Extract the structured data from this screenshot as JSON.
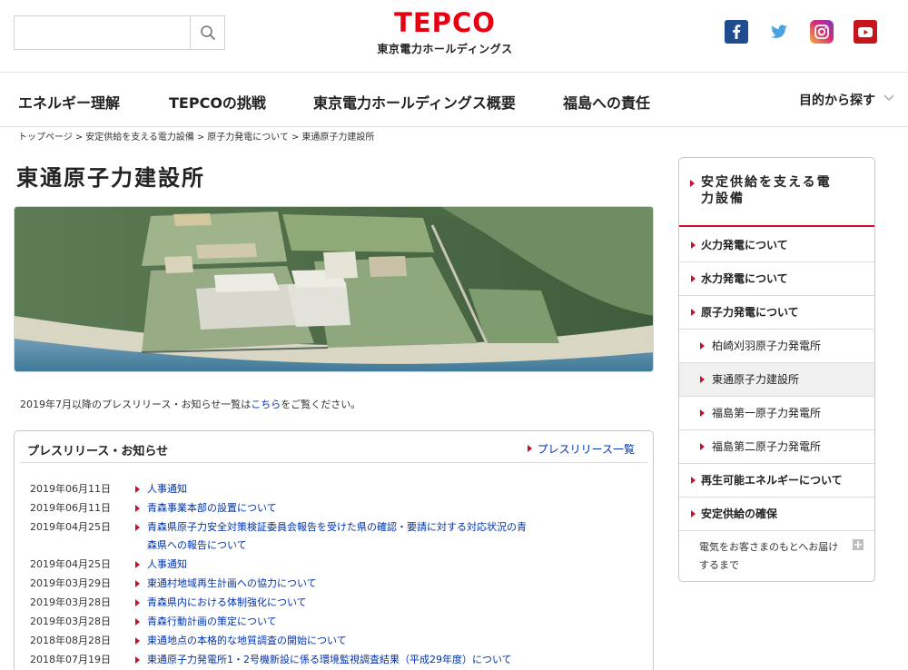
{
  "header": {
    "search_placeholder": "",
    "logo_text": "TEPCO",
    "logo_subtext": "東京電力ホールディングス"
  },
  "social": {
    "facebook": "f",
    "icons": [
      "facebook-icon",
      "twitter-icon",
      "instagram-icon",
      "youtube-icon"
    ]
  },
  "nav": {
    "items": [
      "エネルギー理解",
      "TEPCOの挑戦",
      "東京電力ホールディングス概要",
      "福島への責任"
    ],
    "right_label": "目的から探す"
  },
  "breadcrumb": [
    "トップページ",
    "安定供給を支える電力設備",
    "原子力発電について",
    "東通原子力建設所"
  ],
  "page": {
    "title": "東通原子力建設所"
  },
  "notice": {
    "before": "2019年7月以降のプレスリリース・お知らせ一覧は",
    "link": "こちら",
    "after": "をご覧ください。"
  },
  "press": {
    "heading": "プレスリリース・お知らせ",
    "all_link": "プレスリリース一覧",
    "items": [
      {
        "date": "2019年06月11日",
        "title": "人事通知"
      },
      {
        "date": "2019年06月11日",
        "title": "青森事業本部の設置について"
      },
      {
        "date": "2019年04月25日",
        "title": "青森県原子力安全対策検証委員会報告を受けた県の確認・要請に対する対応状況の青森県への報告について"
      },
      {
        "date": "2019年04月25日",
        "title": "人事通知"
      },
      {
        "date": "2019年03月29日",
        "title": "東通村地域再生計画への協力について"
      },
      {
        "date": "2019年03月28日",
        "title": "青森県内における体制強化について"
      },
      {
        "date": "2019年03月28日",
        "title": "青森行動計画の策定について"
      },
      {
        "date": "2018年08月28日",
        "title": "東通地点の本格的な地質調査の開始について"
      },
      {
        "date": "2018年07月19日",
        "title": "東通原子力発電所1・2号機新設に係る環境監視調査結果（平成29年度）について"
      }
    ]
  },
  "sidebar": {
    "heading": "安定供給を支える電力設備",
    "items": [
      {
        "label": "火力発電について",
        "level": 1
      },
      {
        "label": "水力発電について",
        "level": 1
      },
      {
        "label": "原子力発電について",
        "level": 1
      },
      {
        "label": "柏崎刈羽原子力発電所",
        "level": 2
      },
      {
        "label": "東通原子力建設所",
        "level": 2
      },
      {
        "label": "福島第一原子力発電所",
        "level": 2
      },
      {
        "label": "福島第二原子力発電所",
        "level": 2
      },
      {
        "label": "再生可能エネルギーについて",
        "level": 1
      },
      {
        "label": "安定供給の確保",
        "level": 1
      }
    ],
    "last_item": "電気をお客さまのもとへお届けするまで"
  },
  "colors": {
    "brand_red": "#e60012",
    "link_blue": "#0033aa",
    "accent_red": "#c8102e"
  }
}
